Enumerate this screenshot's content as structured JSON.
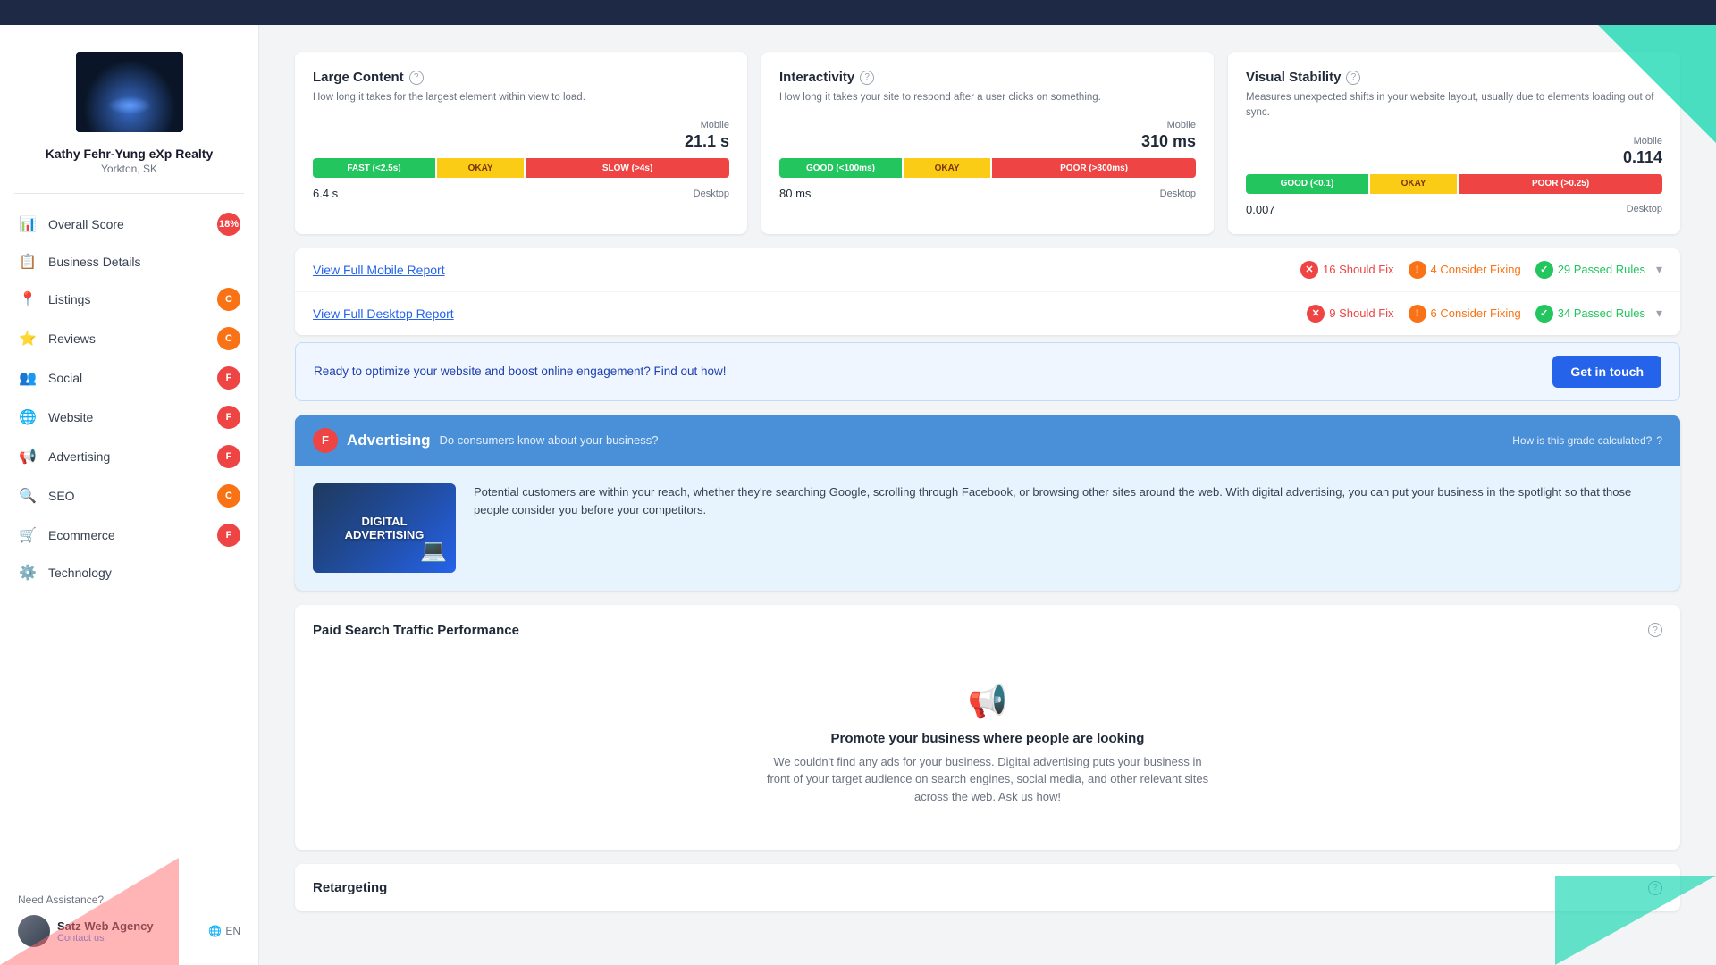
{
  "topbar": {
    "bg": "#1e2a45"
  },
  "sidebar": {
    "business_name": "Kathy Fehr-Yung eXp Realty",
    "business_location": "Yorkton, SK",
    "overall_score_label": "Overall Score",
    "overall_score_value": "18%",
    "items": [
      {
        "id": "overall-score",
        "label": "Overall Score",
        "icon": "📊",
        "badge": "18%",
        "badge_type": "red"
      },
      {
        "id": "business-details",
        "label": "Business Details",
        "icon": "📋",
        "badge": null
      },
      {
        "id": "listings",
        "label": "Listings",
        "icon": "📍",
        "badge": "C",
        "badge_type": "orange"
      },
      {
        "id": "reviews",
        "label": "Reviews",
        "icon": "⭐",
        "badge": "C",
        "badge_type": "orange"
      },
      {
        "id": "social",
        "label": "Social",
        "icon": "👥",
        "badge": "F",
        "badge_type": "red"
      },
      {
        "id": "website",
        "label": "Website",
        "icon": "🌐",
        "badge": "F",
        "badge_type": "red"
      },
      {
        "id": "advertising",
        "label": "Advertising",
        "icon": "📢",
        "badge": "F",
        "badge_type": "red"
      },
      {
        "id": "seo",
        "label": "SEO",
        "icon": "🔍",
        "badge": "C",
        "badge_type": "orange"
      },
      {
        "id": "ecommerce",
        "label": "Ecommerce",
        "icon": "🛒",
        "badge": "F",
        "badge_type": "red"
      },
      {
        "id": "technology",
        "label": "Technology",
        "icon": "⚙️",
        "badge": null
      }
    ],
    "need_assistance_label": "Need Assistance?",
    "agency_name": "Satz Web Agency",
    "agency_contact": "Contact us",
    "lang": "EN"
  },
  "vitals": {
    "cards": [
      {
        "title": "Large Content",
        "info": "?",
        "desc": "How long it takes for the largest element within view to load.",
        "mobile_label": "Mobile",
        "mobile_value": "21.1 s",
        "segments": [
          {
            "label": "FAST (<2.5s)",
            "type": "fast",
            "width": "22%"
          },
          {
            "label": "OKAY",
            "type": "okay",
            "width": "20%"
          },
          {
            "label": "SLOW (>4s)",
            "type": "slow",
            "width": "58%"
          }
        ],
        "desktop_value": "6.4 s",
        "desktop_label": "Desktop"
      },
      {
        "title": "Interactivity",
        "info": "?",
        "desc": "How long it takes your site to respond after a user clicks on something.",
        "mobile_label": "Mobile",
        "mobile_value": "310 ms",
        "segments": [
          {
            "label": "GOOD (<100ms)",
            "type": "good",
            "width": "25%"
          },
          {
            "label": "OKAY",
            "type": "okay",
            "width": "20%"
          },
          {
            "label": "POOR (>300ms)",
            "type": "poor",
            "width": "55%"
          }
        ],
        "desktop_value": "80 ms",
        "desktop_label": "Desktop"
      },
      {
        "title": "Visual Stability",
        "info": "?",
        "desc": "Measures unexpected shifts in your website layout, usually due to elements loading out of sync.",
        "mobile_label": "Mobile",
        "mobile_value": "0.114",
        "segments": [
          {
            "label": "GOOD (<0.1)",
            "type": "good",
            "width": "25%"
          },
          {
            "label": "OKAY",
            "type": "okay",
            "width": "20%"
          },
          {
            "label": "POOR (>0.25)",
            "type": "poor",
            "width": "55%"
          }
        ],
        "desktop_value": "0.007",
        "desktop_label": "Desktop"
      }
    ]
  },
  "reports": {
    "mobile": {
      "link": "View Full Mobile Report",
      "should_fix_count": "16 Should Fix",
      "consider_fixing_count": "4 Consider Fixing",
      "passed_count": "29 Passed Rules"
    },
    "desktop": {
      "link": "View Full Desktop Report",
      "should_fix_count": "9 Should Fix",
      "consider_fixing_count": "6 Consider Fixing",
      "passed_count": "34 Passed Rules"
    }
  },
  "cta": {
    "text": "Ready to optimize your website and boost online engagement? Find out how!",
    "button_label": "Get in touch"
  },
  "advertising": {
    "grade": "F",
    "title": "Advertising",
    "subtitle": "Do consumers know about your business?",
    "how_grade": "How is this grade calculated?",
    "image_text": "DIGITAL ADVERTISING",
    "image_sub": "",
    "body_text": "Potential customers are within your reach, whether they're searching Google, scrolling through Facebook, or browsing other sites around the web. With digital advertising, you can put your business in the spotlight so that those people consider you before your competitors."
  },
  "paid_search": {
    "title": "Paid Search Traffic Performance",
    "empty_icon": "📢",
    "empty_title": "Promote your business where people are looking",
    "empty_desc": "We couldn't find any ads for your business. Digital advertising puts your business in front of your target audience on search engines, social media, and other relevant sites across the web. Ask us how!"
  },
  "retargeting": {
    "title": "Retargeting"
  }
}
